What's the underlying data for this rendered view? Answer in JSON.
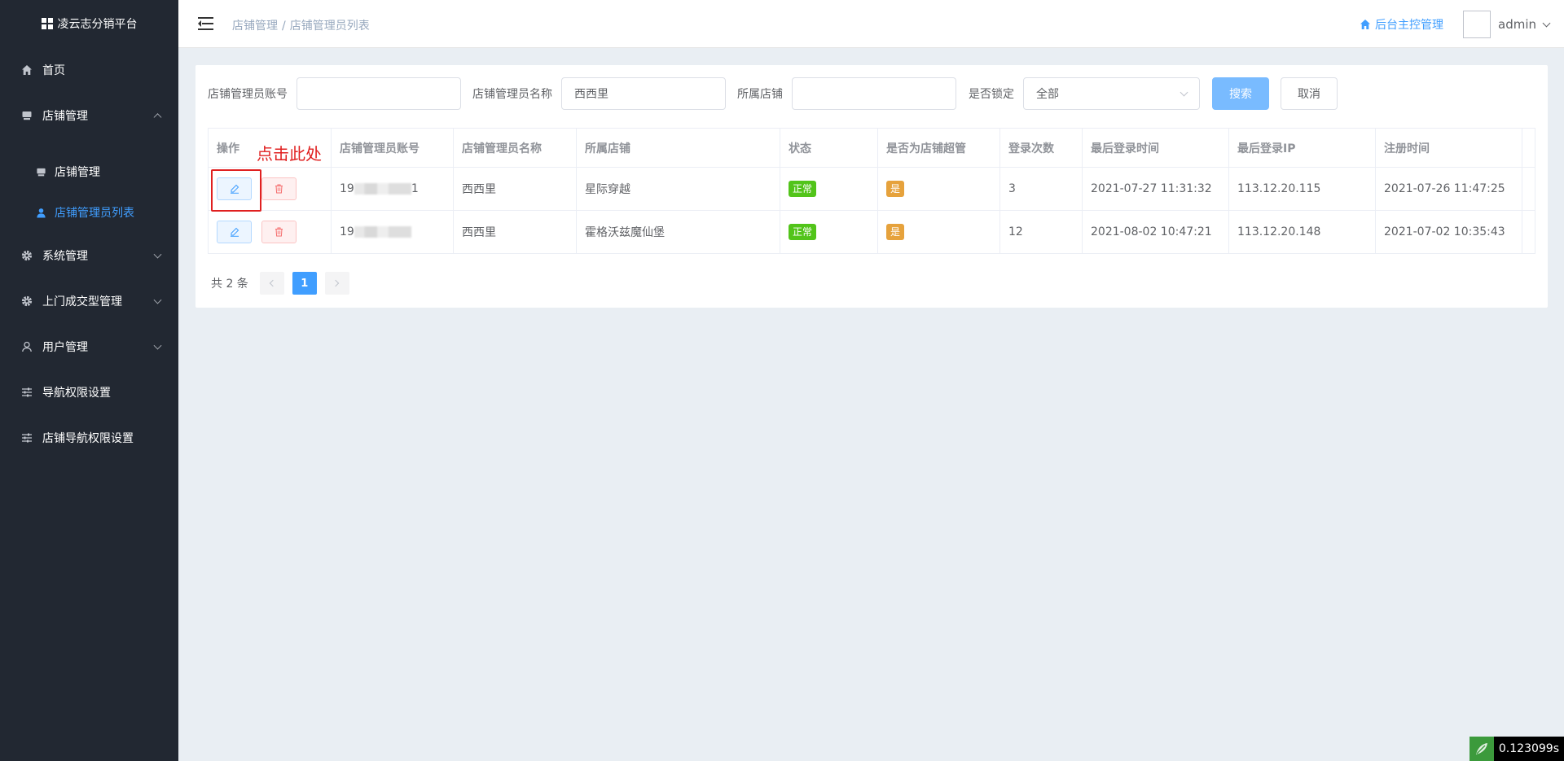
{
  "app": {
    "title": "凌云志分销平台"
  },
  "sidebar": {
    "items": [
      {
        "label": "首页",
        "icon": "home-icon"
      },
      {
        "label": "店铺管理",
        "icon": "shop-icon",
        "expanded": true,
        "children": [
          {
            "label": "店铺管理",
            "icon": "shop-icon"
          },
          {
            "label": "店铺管理员列表",
            "icon": "user-icon",
            "active": true
          }
        ]
      },
      {
        "label": "系统管理",
        "icon": "gear-icon"
      },
      {
        "label": "上门成交型管理",
        "icon": "gear-icon"
      },
      {
        "label": "用户管理",
        "icon": "user-outline-icon"
      },
      {
        "label": "导航权限设置",
        "icon": "sliders-icon"
      },
      {
        "label": "店铺导航权限设置",
        "icon": "sliders-icon"
      }
    ]
  },
  "header": {
    "breadcrumb": [
      "店铺管理",
      "店铺管理员列表"
    ],
    "breadcrumb_sep": "/",
    "home_link": "后台主控管理",
    "user": "admin"
  },
  "search": {
    "account_label": "店铺管理员账号",
    "account_value": "",
    "name_label": "店铺管理员名称",
    "name_value": "西西里",
    "store_label": "所属店铺",
    "store_value": "",
    "locked_label": "是否锁定",
    "locked_value": "全部",
    "search_button": "搜索",
    "cancel_button": "取消"
  },
  "table": {
    "columns": [
      "操作",
      "店铺管理员账号",
      "店铺管理员名称",
      "所属店铺",
      "状态",
      "是否为店铺超管",
      "登录次数",
      "最后登录时间",
      "最后登录IP",
      "注册时间"
    ],
    "rows": [
      {
        "account_prefix": "19",
        "account_suffix": "1",
        "name": "西西里",
        "store": "星际穿越",
        "status": "正常",
        "super": "是",
        "logins": "3",
        "last_login": "2021-07-27 11:31:32",
        "ip": "113.12.20.115",
        "registered": "2021-07-26 11:47:25"
      },
      {
        "account_prefix": "19",
        "account_suffix": "",
        "name": "西西里",
        "store": "霍格沃兹魔仙堡",
        "status": "正常",
        "super": "是",
        "logins": "12",
        "last_login": "2021-08-02 10:47:21",
        "ip": "113.12.20.148",
        "registered": "2021-07-02 10:35:43"
      }
    ]
  },
  "annotation": {
    "text": "点击此处",
    "color": "#e02020"
  },
  "pagination": {
    "total": "共 2 条",
    "current_page": "1"
  },
  "timer": {
    "value": "0.123099s"
  },
  "colors": {
    "sidebar_bg": "#222832",
    "accent": "#409eff",
    "status_green": "#52c41a",
    "tag_orange": "#e6a23c"
  }
}
